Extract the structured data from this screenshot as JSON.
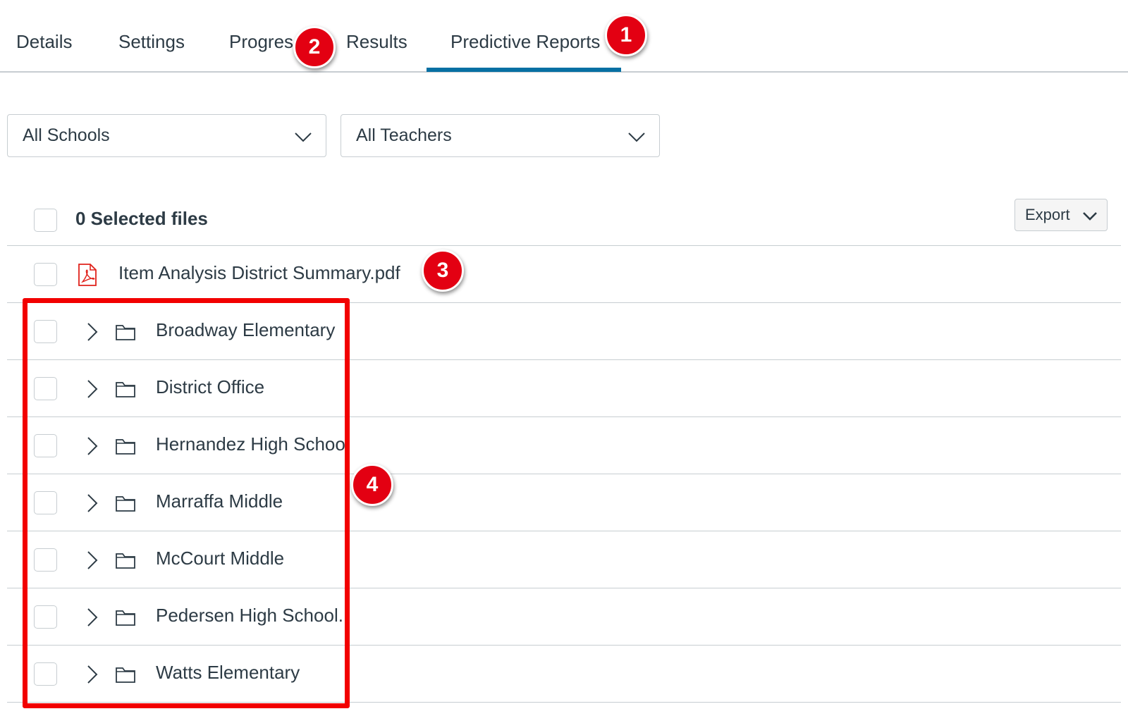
{
  "tabs": [
    {
      "label": "Details"
    },
    {
      "label": "Settings"
    },
    {
      "label": "Progres"
    },
    {
      "label": "Results"
    },
    {
      "label": "Predictive Reports",
      "active": true
    }
  ],
  "filters": {
    "school": {
      "selected": "All Schools"
    },
    "teacher": {
      "selected": "All Teachers"
    }
  },
  "list": {
    "header_label": "0 Selected files",
    "export_label": "Export",
    "file": {
      "name": "Item Analysis District Summary.pdf",
      "icon": "pdf-icon"
    },
    "folders": [
      {
        "name": "Broadway Elementary"
      },
      {
        "name": "District Office"
      },
      {
        "name": "Hernandez High School"
      },
      {
        "name": "Marraffa Middle"
      },
      {
        "name": "McCourt Middle"
      },
      {
        "name": "Pedersen High School."
      },
      {
        "name": "Watts Elementary"
      }
    ]
  },
  "callouts": [
    "1",
    "2",
    "3",
    "4"
  ],
  "colors": {
    "accent": "#0770a3",
    "callout": "#e30012",
    "highlight": "#f20000",
    "text": "#2d3b45",
    "border": "#c7cdd1"
  }
}
